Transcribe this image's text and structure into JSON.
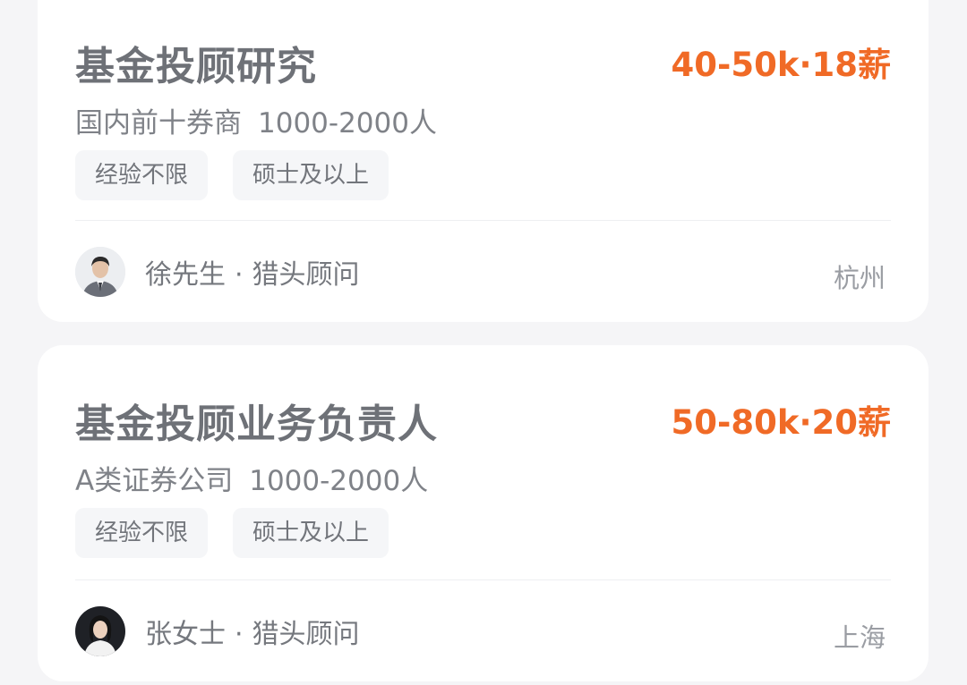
{
  "jobs": [
    {
      "title": "基金投顾研究",
      "salary": "40-50k·18薪",
      "company": "国内前十券商",
      "company_size": "1000-2000人",
      "tags": [
        "经验不限",
        "硕士及以上"
      ],
      "recruiter": {
        "name": "徐先生",
        "separator": "·",
        "role": "猎头顾问",
        "avatar_icon": "avatar-male-icon"
      },
      "city": "杭州"
    },
    {
      "title": "基金投顾业务负责人",
      "salary": "50-80k·20薪",
      "company": "A类证券公司",
      "company_size": "1000-2000人",
      "tags": [
        "经验不限",
        "硕士及以上"
      ],
      "recruiter": {
        "name": "张女士",
        "separator": "·",
        "role": "猎头顾问",
        "avatar_icon": "avatar-female-icon"
      },
      "city": "上海"
    }
  ],
  "colors": {
    "salary": "#f06a26",
    "title": "#6e7177",
    "background": "#f5f5f7",
    "card": "#ffffff",
    "tag_bg": "#f5f6f8"
  }
}
